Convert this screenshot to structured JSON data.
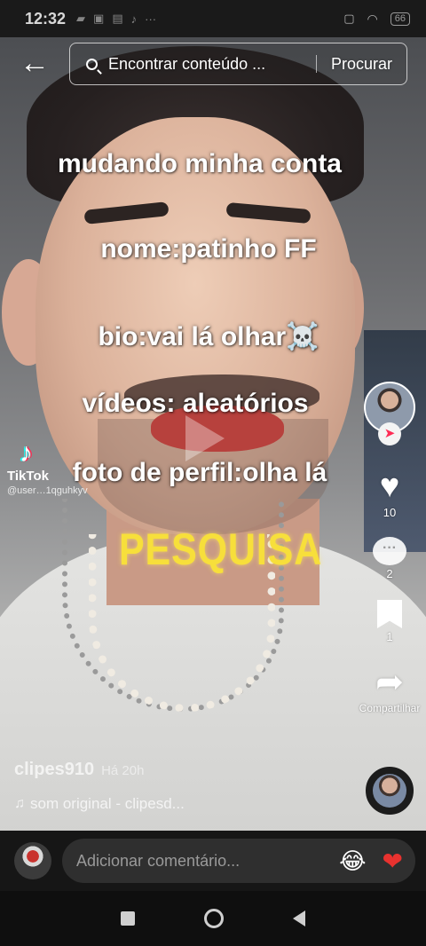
{
  "status_bar": {
    "time": "12:32",
    "left_icons": [
      "video-icon",
      "app-icon",
      "photo-icon",
      "tiktok-icon",
      "more-dots-icon"
    ],
    "right_icons": [
      "screen-icon",
      "wifi-icon",
      "battery-icon"
    ],
    "battery": "66"
  },
  "search": {
    "placeholder": "Encontrar conteúdo ...",
    "button_label": "Procurar"
  },
  "video": {
    "captions": [
      "mudando minha conta",
      "nome:patinho FF",
      "bio:vai lá olhar☠️",
      "vídeos: aleatórios",
      "foto de perfil:olha lá"
    ],
    "highlight_text": "PESQUISA",
    "watermark": {
      "logo": "♪",
      "name": "TikTok",
      "user": "@user…1qguhkyv"
    }
  },
  "actions": {
    "likes": "10",
    "comments": "2",
    "saves": "1",
    "share_label": "Compartilhar"
  },
  "post": {
    "author": "clipes910",
    "time": "Há 20h",
    "music": "som original - clipesd..."
  },
  "comment_bar": {
    "placeholder": "Adicionar comentário...",
    "emoji": "😂",
    "heart": "❤"
  },
  "colors": {
    "caption_highlight": "#f7df3b",
    "like_heart": "#e8322f",
    "follow_plus": "#fe2c55",
    "comment_bar_bg": "#161616"
  }
}
